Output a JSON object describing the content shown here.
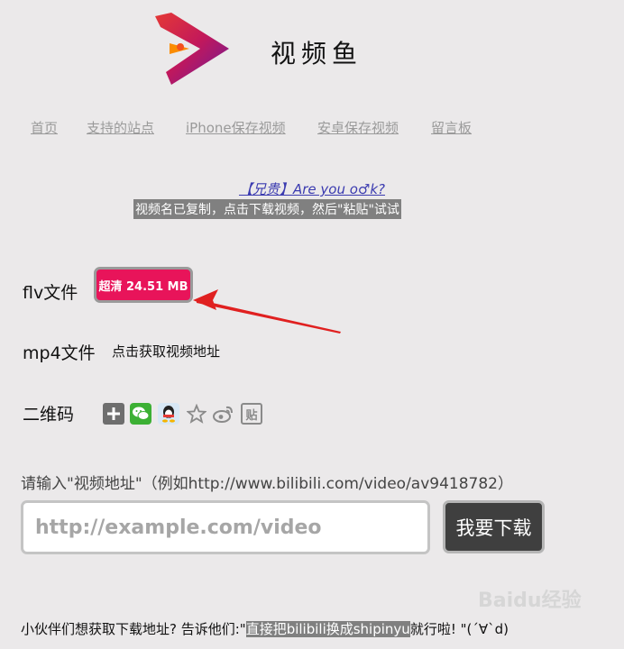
{
  "header": {
    "site_name": "视频鱼"
  },
  "nav": {
    "items": [
      "首页",
      "支持的站点",
      "iPhone保存视频",
      "安卓保存视频",
      "留言板"
    ]
  },
  "video": {
    "title": "【兄贵】Are you o♂k?",
    "copied_hint": "视频名已复制，点击下载视频，然后\"粘贴\"试试"
  },
  "downloads": {
    "flv_label": "flv文件",
    "flv_button": "超清 24.51 MB",
    "mp4_label": "mp4文件",
    "mp4_link": "点击获取视频地址",
    "qr_label": "二维码"
  },
  "share_icons": [
    "plus-icon",
    "wechat-icon",
    "qq-icon",
    "star-icon",
    "weibo-icon",
    "tieba-icon"
  ],
  "form": {
    "instruction": "请输入\"视频地址\"（例如http://www.bilibili.com/video/av9418782）",
    "placeholder": "http://example.com/video",
    "submit_label": "我要下载"
  },
  "footer": {
    "tip_prefix": "小伙伴们想获取下载地址? 告诉他们:\"",
    "tip_highlight": "直接把bilibili换成shipinyu",
    "tip_suffix": "就行啦! \"(´∀`d)"
  },
  "watermark": "Baidu经验",
  "colors": {
    "download_button": "#e8145a",
    "submit_button": "#3f3f3f",
    "logo_purple": "#7b1fa2",
    "logo_orange": "#f4511e",
    "arrow": "#e02020"
  }
}
